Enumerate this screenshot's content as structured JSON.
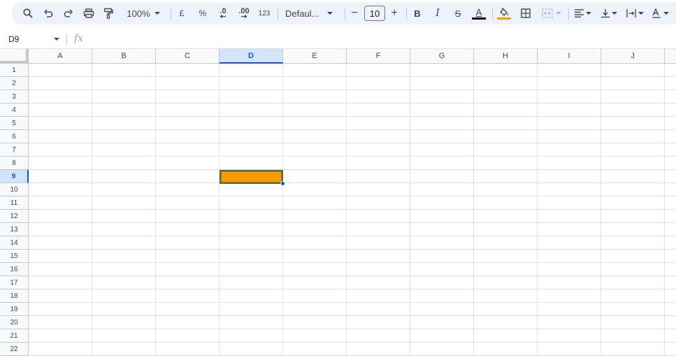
{
  "toolbar": {
    "zoom": "100%",
    "currency": "£",
    "percent": "%",
    "decrease_decimal": ".0",
    "increase_decimal": ".00",
    "number_format": "123",
    "font_name": "Defaul...",
    "font_size": "10",
    "minus": "−",
    "plus": "+",
    "bold": "B",
    "italic": "I",
    "strike": "S",
    "text_color_letter": "A",
    "text_color": "#000000",
    "fill_color": "#ff9900"
  },
  "formula_bar": {
    "name_box": "D9",
    "fx_label": "fx",
    "value": ""
  },
  "sheet": {
    "columns": [
      "A",
      "B",
      "C",
      "D",
      "E",
      "F",
      "G",
      "H",
      "I",
      "J"
    ],
    "rows": [
      "1",
      "2",
      "3",
      "4",
      "5",
      "6",
      "7",
      "8",
      "9",
      "10",
      "11",
      "12",
      "13",
      "14",
      "15",
      "16",
      "17",
      "18",
      "19",
      "20",
      "21",
      "22"
    ],
    "selected_column": "D",
    "selected_row": "9",
    "active_cell_fill": "#ff9900"
  }
}
